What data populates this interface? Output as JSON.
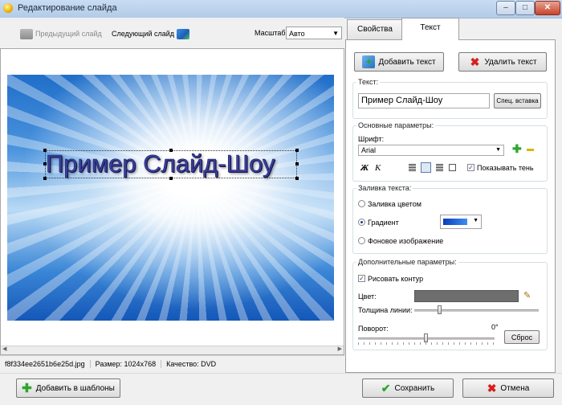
{
  "window": {
    "title": "Редактирование слайда",
    "controls": {
      "minimize": "–",
      "maximize": "□",
      "close": "✕"
    }
  },
  "toolbar": {
    "prev_label": "Предыдущий слайд",
    "next_label": "Следующий слайд",
    "zoom_label": "Масштаб:",
    "zoom_value": "Авто"
  },
  "slide": {
    "text": "Пример Слайд-Шоу"
  },
  "status": {
    "filename": "f8f334ee2651b6e25d.jpg",
    "size": "Размер: 1024x768",
    "quality": "Качество: DVD"
  },
  "tabs": [
    {
      "label": "Свойства"
    },
    {
      "label": "Текст"
    }
  ],
  "text_panel": {
    "add_text": "Добавить текст",
    "delete_text": "Удалить текст",
    "text_group_title": "Текст:",
    "text_value": "Пример Слайд-Шоу",
    "special_insert": "Спец. вставка",
    "basic_group_title": "Основные параметры:",
    "font_label": "Шрифт:",
    "font_value": "Arial",
    "bold_label": "Ж",
    "italic_label": "К",
    "shadow_label": "Показывать тень",
    "fill_group_title": "Заливка текста:",
    "fill_color": "Заливка цветом",
    "fill_gradient": "Градиент",
    "fill_image": "Фоновое изображение",
    "extra_group_title": "Дополнительные параметры:",
    "outline_label": "Рисовать контур",
    "color_label": "Цвет:",
    "line_width_label": "Толщина линии:",
    "rotation_label": "Поворот:",
    "rotation_value": "0°",
    "reset": "Сброс"
  },
  "footer": {
    "add_template": "Добавить в шаблоны",
    "save": "Сохранить",
    "cancel": "Отмена"
  },
  "colors": {
    "outline_color": "#6e6e6e",
    "gradient_start": "#0a3cb8",
    "gradient_end": "#3f8ef0"
  }
}
